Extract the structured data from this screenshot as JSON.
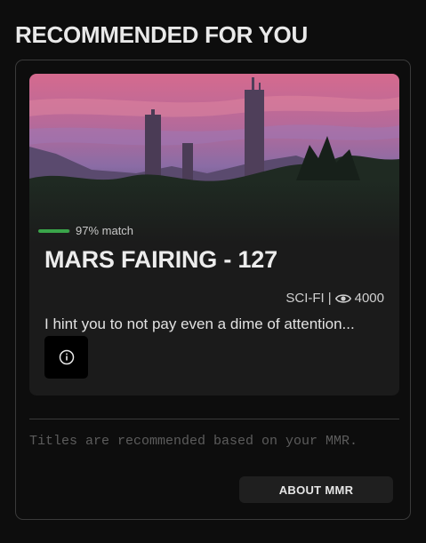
{
  "section": {
    "title": "RECOMMENDED FOR YOU"
  },
  "card": {
    "match_text": "97% match",
    "match_percent": 97,
    "match_color": "#3aa54a",
    "title": "MARS FAIRING - 127",
    "genre": "SCI-FI",
    "separator": "|",
    "views": "4000",
    "views_icon": "eye-icon",
    "description": "I hint you to not pay even a dime of attention...",
    "info_icon": "info-icon"
  },
  "footer": {
    "note": "Titles are recommended based on your MMR.",
    "about_button": "ABOUT MMR"
  }
}
